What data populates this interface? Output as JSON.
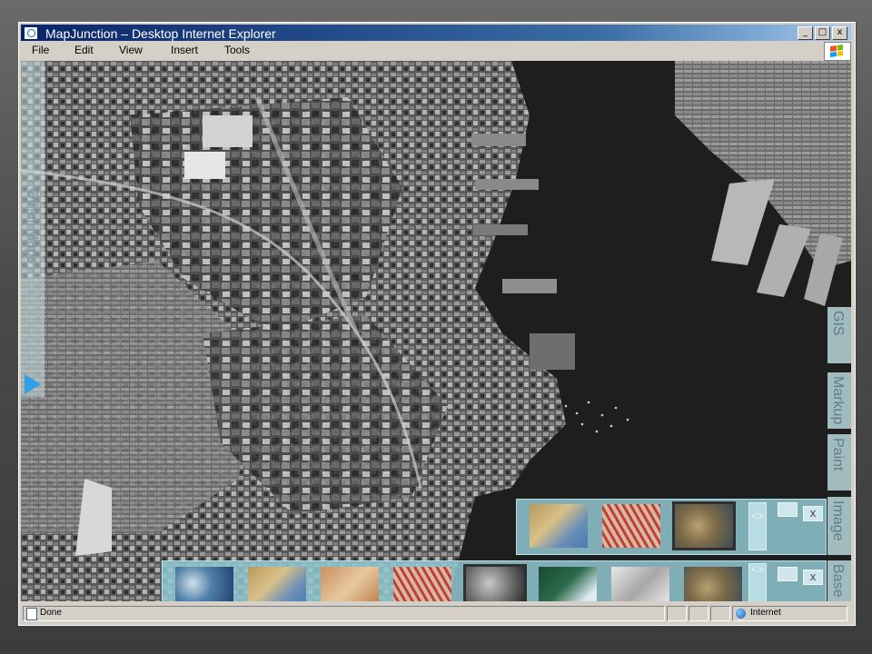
{
  "window": {
    "title": "MapJunction – Desktop  Internet Explorer",
    "controls": {
      "minimize": "_",
      "maximize": "□",
      "close": "x"
    }
  },
  "menu": [
    "File",
    "Edit",
    "View",
    "Insert",
    "Tools"
  ],
  "status": {
    "left": "Done",
    "zone": "Internet"
  },
  "panels": {
    "other_maps": "Other Maps",
    "tabs": {
      "gis": "GIS",
      "markup": "Markup",
      "paint": "Paint",
      "image": "Image",
      "base": "Base"
    }
  },
  "trays": {
    "image": {
      "thumbs": [
        {
          "style": "tan",
          "selected": false
        },
        {
          "style": "red-streets",
          "selected": false
        },
        {
          "style": "sepia-old",
          "selected": true
        }
      ],
      "nav": "<>",
      "close": "x"
    },
    "base": {
      "thumbs": [
        {
          "style": "blue-aerial",
          "selected": false
        },
        {
          "style": "tan",
          "selected": false
        },
        {
          "style": "brown-old",
          "selected": false
        },
        {
          "style": "red-streets",
          "selected": false
        },
        {
          "style": "bw-aerial",
          "selected": true
        },
        {
          "style": "green-dark",
          "selected": false
        },
        {
          "style": "gray-map",
          "selected": false
        },
        {
          "style": "sepia-old",
          "selected": false
        }
      ],
      "nav": "<>",
      "close": "x"
    }
  },
  "colors": {
    "title_gradient_start": "#0a246a",
    "panel_tint": "#91c8d2",
    "arrow": "#2fa0e8",
    "water": "#1e1e1e"
  }
}
